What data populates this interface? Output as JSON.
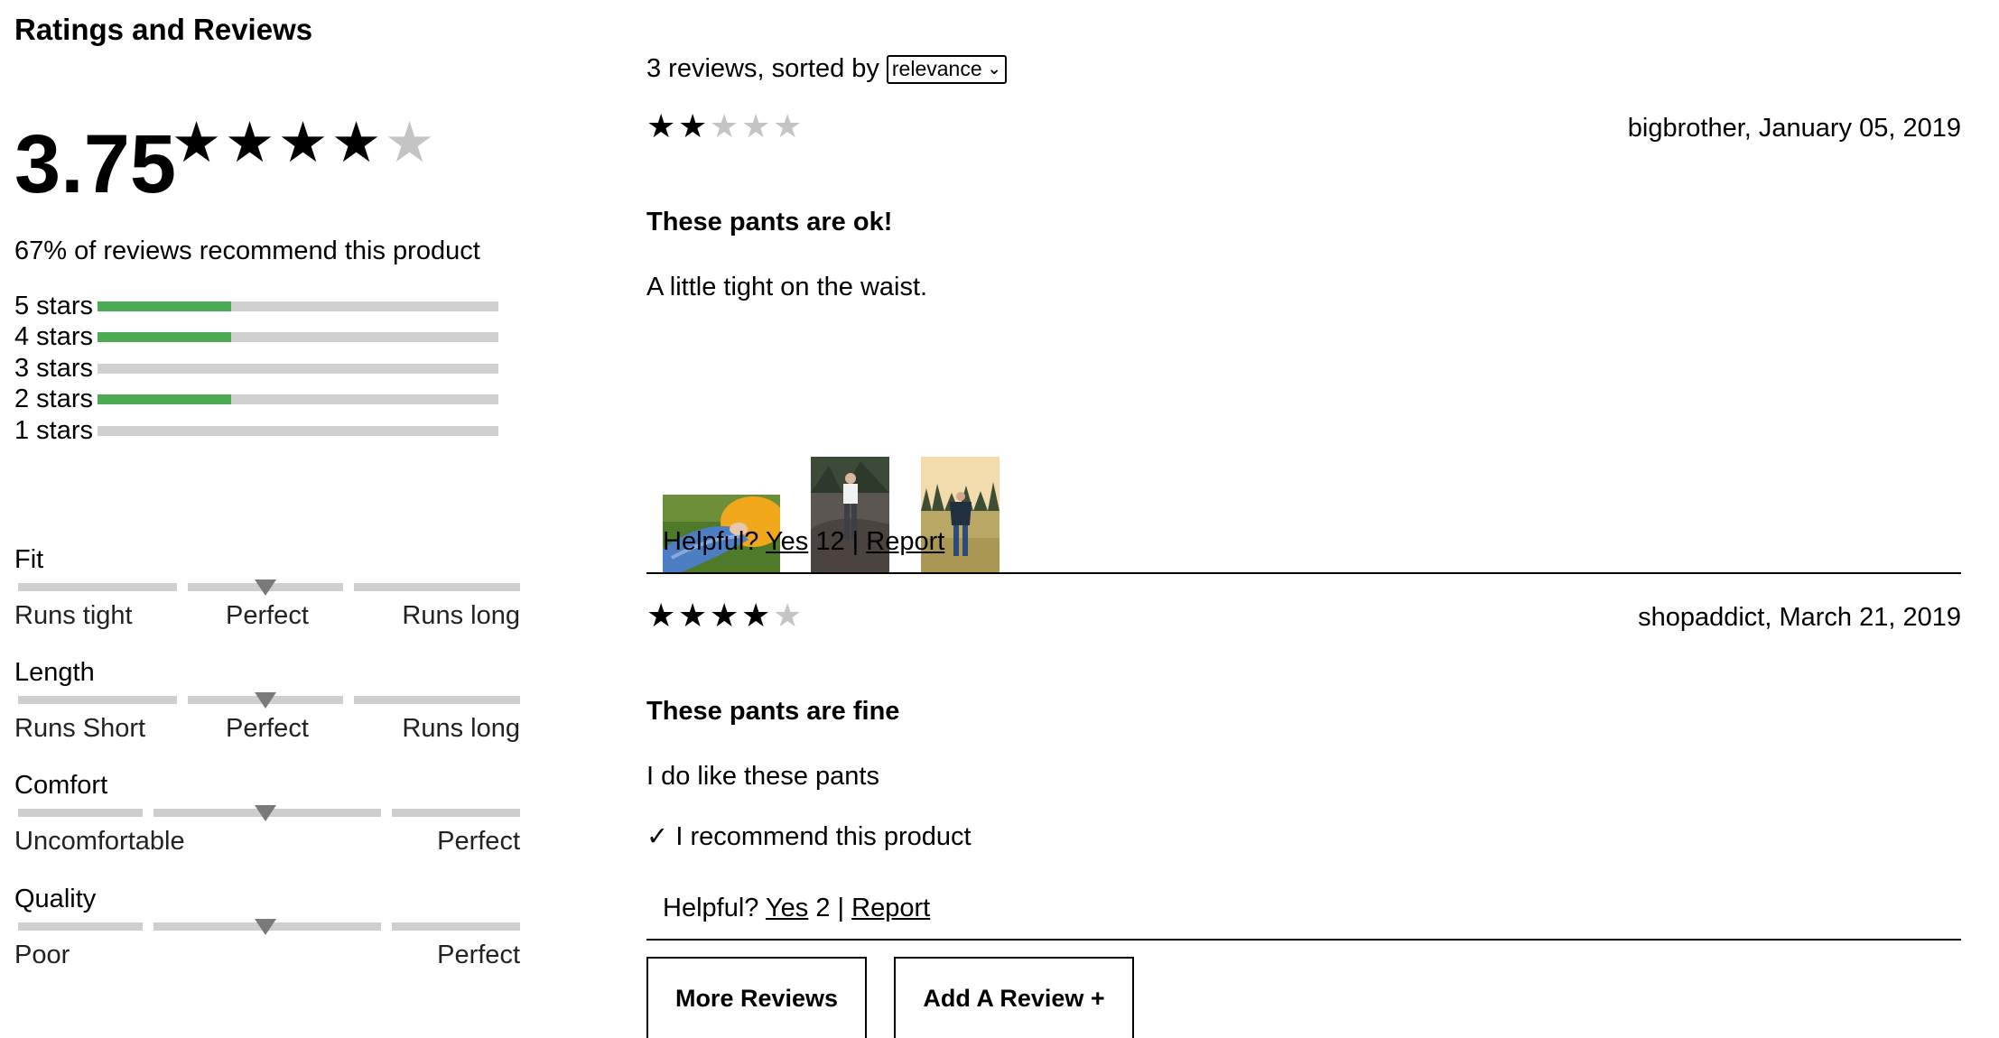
{
  "section_title": "Ratings and Reviews",
  "summary": {
    "average": "3.75",
    "average_value": 3.75,
    "stars": [
      "★",
      "★",
      "★",
      "★",
      "★"
    ],
    "recommend_text": "67% of reviews recommend this product"
  },
  "breakdown": [
    {
      "label": "5 stars",
      "fraction": 0.333
    },
    {
      "label": "4 stars",
      "fraction": 0.333
    },
    {
      "label": "3 stars",
      "fraction": 0
    },
    {
      "label": "2 stars",
      "fraction": 0.333
    },
    {
      "label": "1 stars",
      "fraction": 0
    }
  ],
  "characteristics": [
    {
      "name": "Fit",
      "labels": [
        "Runs tight",
        "Perfect",
        "Runs long"
      ],
      "value": 0.5
    },
    {
      "name": "Length",
      "labels": [
        "Runs Short",
        "Perfect",
        "Runs long"
      ],
      "value": 0.5
    },
    {
      "name": "Comfort",
      "labels": [
        "Uncomfortable",
        "Perfect"
      ],
      "value": 0.5
    },
    {
      "name": "Quality",
      "labels": [
        "Poor",
        "Perfect"
      ],
      "value": 0.5
    }
  ],
  "sort": {
    "prefix": "3 reviews, sorted by",
    "selected": "relevance"
  },
  "reviews": [
    {
      "rating": 2,
      "author_date": "bigbrother, January 05, 2019",
      "title": "These pants are ok!",
      "body": "A little tight on the waist.",
      "recommend": "",
      "helpful_prefix": "Helpful?",
      "yes_label": "Yes",
      "yes_count": "12",
      "separator": "|",
      "report_label": "Report",
      "photos": [
        "photo-jeans-lying",
        "photo-person-rocks",
        "photo-person-field"
      ]
    },
    {
      "rating": 4,
      "author_date": "shopaddict, March 21, 2019",
      "title": "These pants are fine",
      "body": "I do like these pants",
      "recommend": "✓ I recommend this product",
      "helpful_prefix": "Helpful?",
      "yes_label": "Yes",
      "yes_count": "2",
      "separator": "|",
      "report_label": "Report",
      "photos": []
    }
  ],
  "buttons": {
    "more_reviews": "More Reviews",
    "add_review": "Add A Review +"
  },
  "colors": {
    "bar_fill": "#4caa53",
    "bar_track": "#d0d0d0",
    "star_filled": "#000000",
    "star_empty": "#c4c4c4",
    "marker": "#7a7a7a"
  }
}
